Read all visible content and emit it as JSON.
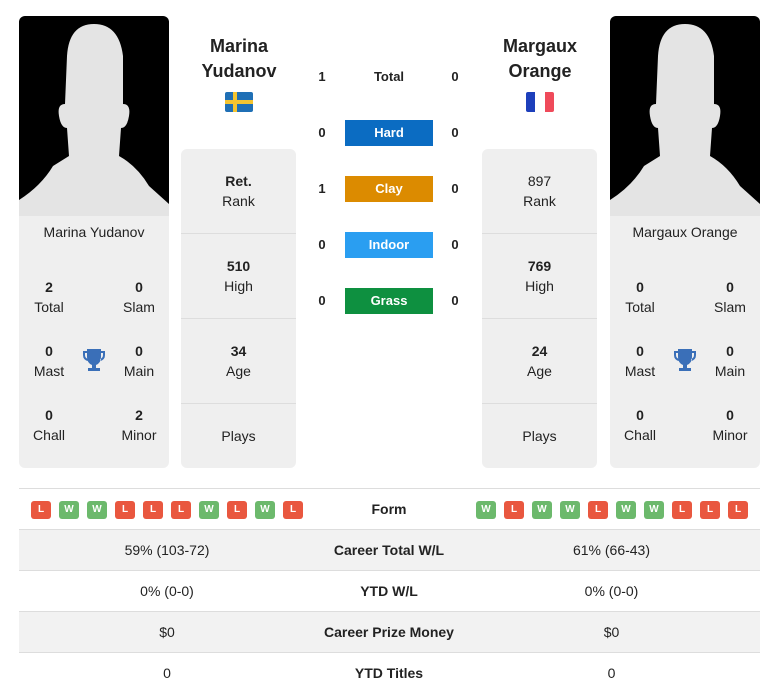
{
  "colors": {
    "hard": "#0b6cc2",
    "clay": "#dc8b00",
    "indoor": "#2a9ef1",
    "grass": "#0e9040",
    "win": "#6cb96c",
    "loss": "#e9573f",
    "trophy": "#3a6fb8"
  },
  "player1": {
    "title_line1": "Marina",
    "title_line2": "Yudanov",
    "name": "Marina Yudanov",
    "flag": "sweden-flag-icon",
    "rank": "Ret.",
    "rank_label": "Rank",
    "high": "510",
    "high_label": "High",
    "age": "34",
    "age_label": "Age",
    "plays_label": "Plays",
    "stats": {
      "total": "2",
      "total_label": "Total",
      "slam": "0",
      "slam_label": "Slam",
      "mast": "0",
      "mast_label": "Mast",
      "main": "0",
      "main_label": "Main",
      "chall": "0",
      "chall_label": "Chall",
      "minor": "2",
      "minor_label": "Minor"
    },
    "form": [
      "L",
      "W",
      "W",
      "L",
      "L",
      "L",
      "W",
      "L",
      "W",
      "L"
    ]
  },
  "player2": {
    "title_line1": "Margaux",
    "title_line2": "Orange",
    "name": "Margaux Orange",
    "flag": "france-flag-icon",
    "rank": "897",
    "rank_label": "Rank",
    "high": "769",
    "high_label": "High",
    "age": "24",
    "age_label": "Age",
    "plays_label": "Plays",
    "stats": {
      "total": "0",
      "total_label": "Total",
      "slam": "0",
      "slam_label": "Slam",
      "mast": "0",
      "mast_label": "Mast",
      "main": "0",
      "main_label": "Main",
      "chall": "0",
      "chall_label": "Chall",
      "minor": "0",
      "minor_label": "Minor"
    },
    "form": [
      "W",
      "L",
      "W",
      "W",
      "L",
      "W",
      "W",
      "L",
      "L",
      "L"
    ]
  },
  "h2h": [
    {
      "label": "Total",
      "p1": "1",
      "p2": "0"
    },
    {
      "label": "Hard",
      "p1": "0",
      "p2": "0"
    },
    {
      "label": "Clay",
      "p1": "1",
      "p2": "0"
    },
    {
      "label": "Indoor",
      "p1": "0",
      "p2": "0"
    },
    {
      "label": "Grass",
      "p1": "0",
      "p2": "0"
    }
  ],
  "table": [
    {
      "label": "Form"
    },
    {
      "label": "Career Total W/L",
      "p1": "59% (103-72)",
      "p2": "61% (66-43)"
    },
    {
      "label": "YTD W/L",
      "p1": "0% (0-0)",
      "p2": "0% (0-0)"
    },
    {
      "label": "Career Prize Money",
      "p1": "$0",
      "p2": "$0"
    },
    {
      "label": "YTD Titles",
      "p1": "0",
      "p2": "0"
    }
  ]
}
